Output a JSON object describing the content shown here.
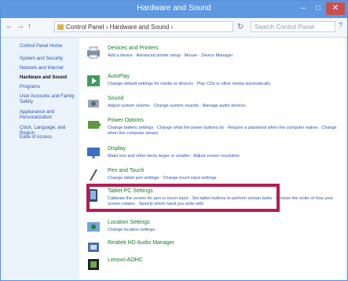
{
  "window": {
    "title": "Hardware and Sound",
    "min": "–",
    "max": "□",
    "close": "✕"
  },
  "address": {
    "back": "←",
    "forward": "→",
    "up": "↑",
    "path": "Control Panel › Hardware and Sound ›",
    "refresh": "↻",
    "search_placeholder": "Search Control Panel",
    "help": "?"
  },
  "sidebar": {
    "items": [
      "Control Panel Home",
      "System and Security",
      "Network and Internet",
      "Hardware and Sound",
      "Programs",
      "User Accounts and Family Safety",
      "Appearance and Personalization",
      "Clock, Language, and Region",
      "Ease of Access"
    ]
  },
  "categories": [
    {
      "title": "Devices and Printers",
      "links": "Add a device · Advanced printer setup · Mouse · Device Manager"
    },
    {
      "title": "AutoPlay",
      "links": "Change default settings for media or devices · Play CDs or other media automatically"
    },
    {
      "title": "Sound",
      "links": "Adjust system volume · Change system sounds · Manage audio devices"
    },
    {
      "title": "Power Options",
      "links": "Change battery settings · Change what the power buttons do · Require a password when the computer wakes · Change when the computer sleeps"
    },
    {
      "title": "Display",
      "links": "Make text and other items larger or smaller · Adjust screen resolution"
    },
    {
      "title": "Pen and Touch",
      "links": "Change tablet pen settings · Change touch input settings"
    },
    {
      "title": "Tablet PC Settings",
      "links": "Calibrate the screen for pen or touch input · Set tablet buttons to perform certain tasks · Choose the order of how your screen rotates · Specify which hand you write with"
    },
    {
      "title": "Location Settings",
      "links": "Change location settings"
    },
    {
      "title": "Realtek HD Audio Manager",
      "links": ""
    },
    {
      "title": "Lenovo AOHC",
      "links": ""
    }
  ],
  "colors": {
    "accent": "#5d98e0",
    "highlight": "#b21f54",
    "category_title": "#1a7a2a",
    "link": "#2b56a8"
  }
}
